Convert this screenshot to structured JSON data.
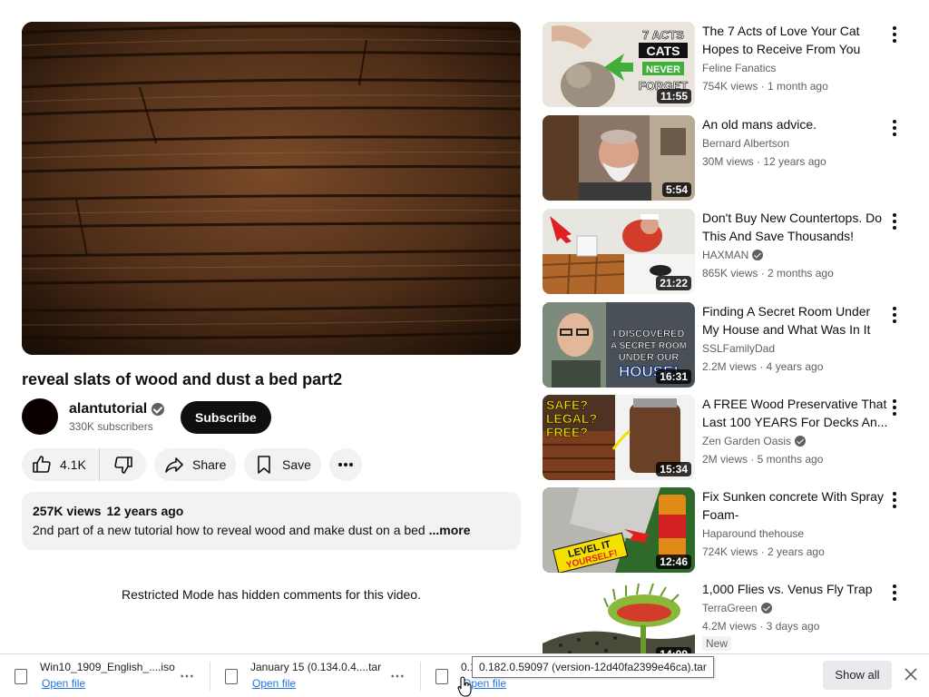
{
  "video": {
    "title": "reveal slats of wood and dust a bed part2",
    "channel": "alantutorial",
    "subscribers": "330K subscribers",
    "subscribe_label": "Subscribe",
    "likes": "4.1K",
    "share_label": "Share",
    "save_label": "Save",
    "views": "257K views",
    "age": "12 years ago",
    "description": "2nd part of a new tutorial how to reveal wood and make dust on a bed",
    "more_label": "...more",
    "restricted_notice": "Restricted Mode has hidden comments for this video."
  },
  "recommendations": [
    {
      "title": "The 7 Acts of Love Your Cat Hopes to Receive From You",
      "channel": "Feline Fanatics",
      "verified": false,
      "stats": "754K views · 1 month ago",
      "duration": "11:55",
      "thumb_icon": "cat-thumbnail"
    },
    {
      "title": "An old mans advice.",
      "channel": "Bernard Albertson",
      "verified": false,
      "stats": "30M views · 12 years ago",
      "duration": "5:54",
      "thumb_icon": "old-man-thumbnail"
    },
    {
      "title": "Don't Buy New Countertops. Do This And Save Thousands!",
      "channel": "HAXMAN",
      "verified": true,
      "stats": "865K views · 2 months ago",
      "duration": "21:22",
      "thumb_icon": "countertop-thumbnail"
    },
    {
      "title": "Finding A Secret Room Under My House and What Was In It",
      "channel": "SSLFamilyDad",
      "verified": false,
      "stats": "2.2M views · 4 years ago",
      "duration": "16:31",
      "thumb_icon": "secret-room-thumbnail"
    },
    {
      "title": "A FREE Wood Preservative That Last 100 YEARS For Decks An...",
      "channel": "Zen Garden Oasis",
      "verified": true,
      "stats": "2M views · 5 months ago",
      "duration": "15:34",
      "thumb_icon": "wood-preservative-thumbnail"
    },
    {
      "title": "Fix Sunken concrete With Spray Foam-",
      "channel": "Haparound thehouse",
      "verified": false,
      "stats": "724K views · 2 years ago",
      "duration": "12:46",
      "thumb_icon": "concrete-thumbnail"
    },
    {
      "title": "1,000 Flies vs. Venus Fly Trap",
      "channel": "TerraGreen",
      "verified": true,
      "stats": "4.2M views · 3 days ago",
      "duration": "14:09",
      "badge": "New",
      "thumb_icon": "venus-fly-trap-thumbnail"
    }
  ],
  "thumb_text": {
    "cat_line1": "7 ACTS",
    "cat_line2": "CATS",
    "cat_line3": "NEVER",
    "cat_line4": "FORGET",
    "room_line1": "I DISCOVERED",
    "room_line2": "A SECRET ROOM",
    "room_line3": "UNDER OUR",
    "room_line4": "HOUSE!",
    "wood_line1": "SAFE?",
    "wood_line2": "LEGAL?",
    "wood_line3": "FREE?",
    "concrete_line1": "LEVEL IT",
    "concrete_line2": "YOURSELF!"
  },
  "downloads": {
    "items": [
      {
        "name": "Win10_1909_English_....iso",
        "open_label": "Open file"
      },
      {
        "name": "January 15 (0.134.0.4....tar",
        "open_label": "Open file"
      },
      {
        "name": "0.1",
        "open_label": "Open file"
      }
    ],
    "tooltip": "0.182.0.59097 (version-12d40fa2399e46ca).tar",
    "show_all_label": "Show all"
  }
}
